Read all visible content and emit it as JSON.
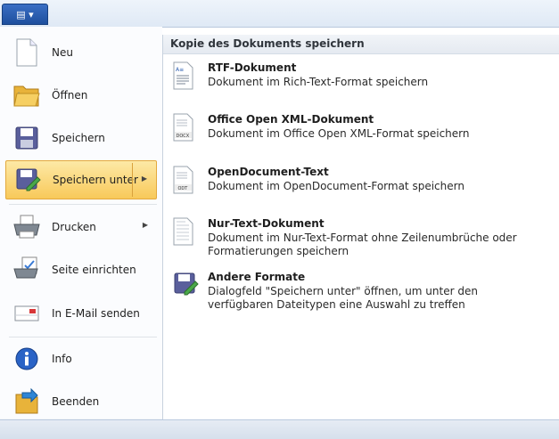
{
  "app_button": {
    "label": "▤ ▾"
  },
  "menu": {
    "items": [
      {
        "label": "Neu",
        "icon": "new-document-icon"
      },
      {
        "label": "Öffnen",
        "icon": "open-folder-icon"
      },
      {
        "label": "Speichern",
        "icon": "save-disk-icon"
      },
      {
        "label": "Speichern unter",
        "icon": "save-as-icon",
        "selected": true,
        "has_submenu": true
      },
      {
        "label": "Drucken",
        "icon": "printer-icon",
        "has_submenu": true
      },
      {
        "label": "Seite einrichten",
        "icon": "page-setup-icon"
      },
      {
        "label": "In E-Mail senden",
        "icon": "email-icon"
      },
      {
        "label": "Info",
        "icon": "info-icon"
      },
      {
        "label": "Beenden",
        "icon": "exit-icon"
      }
    ]
  },
  "submenu": {
    "header": "Kopie des Dokuments speichern",
    "options": [
      {
        "title": "RTF-Dokument",
        "desc": "Dokument im Rich-Text-Format speichern",
        "icon": "rtf-document-icon"
      },
      {
        "title": "Office Open XML-Dokument",
        "desc": "Dokument im Office Open XML-Format speichern",
        "icon": "docx-document-icon"
      },
      {
        "title": "OpenDocument-Text",
        "desc": "Dokument im OpenDocument-Format speichern",
        "icon": "odt-document-icon"
      },
      {
        "title": "Nur-Text-Dokument",
        "desc": "Dokument im Nur-Text-Format ohne Zeilenumbrüche oder Formatierungen speichern",
        "icon": "text-document-icon"
      },
      {
        "title": "Andere Formate",
        "desc": "Dialogfeld \"Speichern unter\" öffnen, um unter den verfügbaren Dateitypen eine Auswahl zu treffen",
        "icon": "other-formats-icon"
      }
    ]
  },
  "colors": {
    "selection": "#f8c95a",
    "app_button": "#2a5db0"
  }
}
